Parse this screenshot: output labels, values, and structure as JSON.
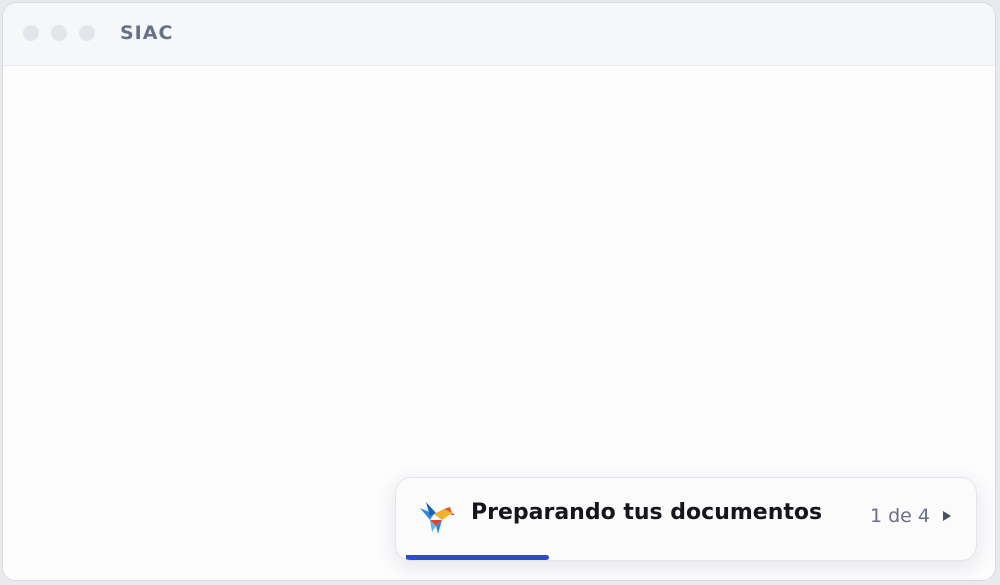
{
  "window": {
    "title": "SIAC",
    "controls": [
      "close-dot",
      "minimize-dot",
      "maximize-dot"
    ]
  },
  "toast": {
    "logo_icon": "hummingbird-logo-icon",
    "message": "Preparando tus documentos",
    "counter": "1 de 4",
    "next_icon": "play-triangle-icon",
    "progress": 0.25,
    "progress_color": "#2d4bd1"
  },
  "colors": {
    "title_text": "#667086",
    "accent": "#2d4bd1"
  }
}
